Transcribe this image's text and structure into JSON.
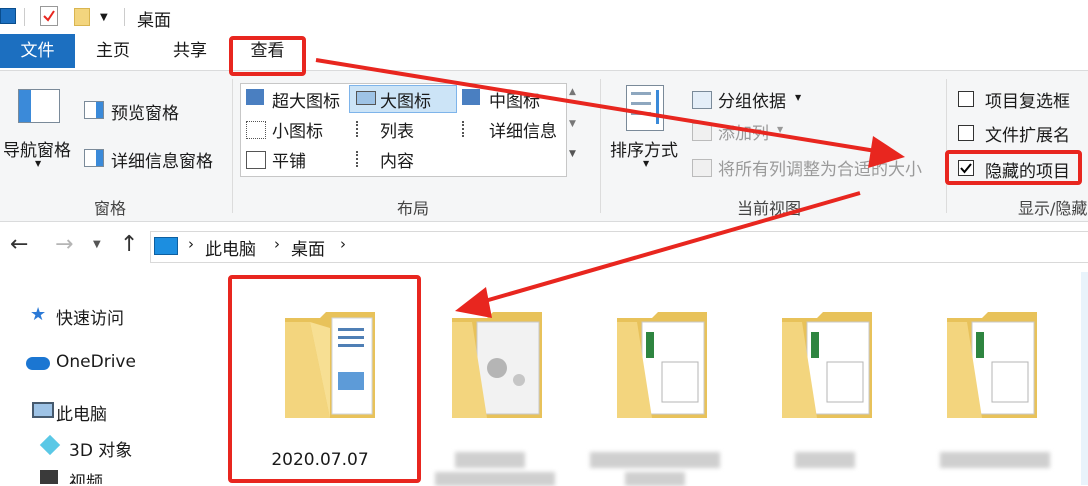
{
  "window": {
    "title": "桌面"
  },
  "tabs": {
    "file": "文件",
    "home": "主页",
    "share": "共享",
    "view": "查看"
  },
  "ribbon": {
    "panes": {
      "nav_pane": "导航窗格",
      "preview_pane": "预览窗格",
      "details_pane": "详细信息窗格",
      "group_label": "窗格"
    },
    "layout": {
      "xl_icons": "超大图标",
      "l_icons": "大图标",
      "m_icons": "中图标",
      "s_icons": "小图标",
      "list": "列表",
      "details": "详细信息",
      "tiles": "平铺",
      "content": "内容",
      "group_label": "布局"
    },
    "current_view": {
      "sort_by": "排序方式",
      "group_by": "分组依据",
      "add_columns": "添加列",
      "size_columns": "将所有列调整为合适的大小",
      "group_label": "当前视图"
    },
    "show_hide": {
      "item_checkboxes": {
        "label": "项目复选框",
        "checked": false
      },
      "file_extensions": {
        "label": "文件扩展名",
        "checked": false
      },
      "hidden_items": {
        "label": "隐藏的项目",
        "checked": true
      },
      "group_label": "显示/隐藏"
    }
  },
  "address": {
    "crumbs": [
      "此电脑",
      "桌面"
    ]
  },
  "nav": {
    "quick_access": "快速访问",
    "onedrive": "OneDrive",
    "this_pc": "此电脑",
    "objects3d": "3D 对象",
    "videos": "视频"
  },
  "files": {
    "first_name": "2020.07.07"
  },
  "colors": {
    "accent": "#1c6fc0",
    "highlight": "#e8261f",
    "folder": "#f3d57e"
  }
}
